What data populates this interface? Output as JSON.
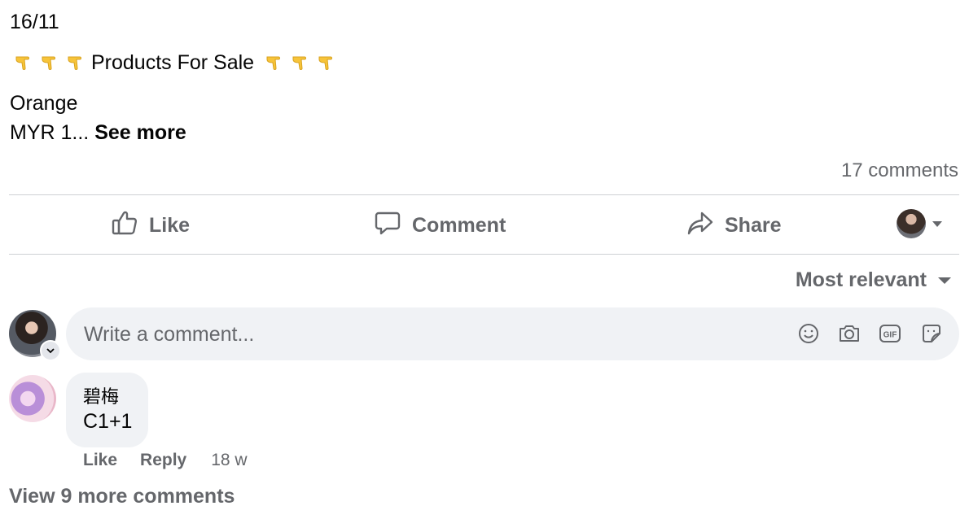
{
  "post": {
    "date": "16/11",
    "title_text": "Products For Sale",
    "title_emoji_icon": "backhand-index-pointing-down-icon",
    "line_product": "Orange",
    "line_price_truncated": "MYR 1...",
    "see_more": "See more",
    "comments_count": "17 comments"
  },
  "actions": {
    "like": "Like",
    "comment": "Comment",
    "share": "Share"
  },
  "sort": {
    "label": "Most relevant"
  },
  "composer": {
    "placeholder": "Write a comment...",
    "icons": [
      "emoji-icon",
      "camera-icon",
      "gif-icon",
      "sticker-icon"
    ]
  },
  "comments": [
    {
      "author": "碧梅",
      "text": "C1+1",
      "like_label": "Like",
      "reply_label": "Reply",
      "time": "18 w"
    }
  ],
  "view_more": "View 9 more comments",
  "colors": {
    "secondary_text": "#65676b",
    "bubble_bg": "#f0f2f5",
    "divider": "#ced0d4",
    "emoji_yellow": "#f7c43a"
  }
}
